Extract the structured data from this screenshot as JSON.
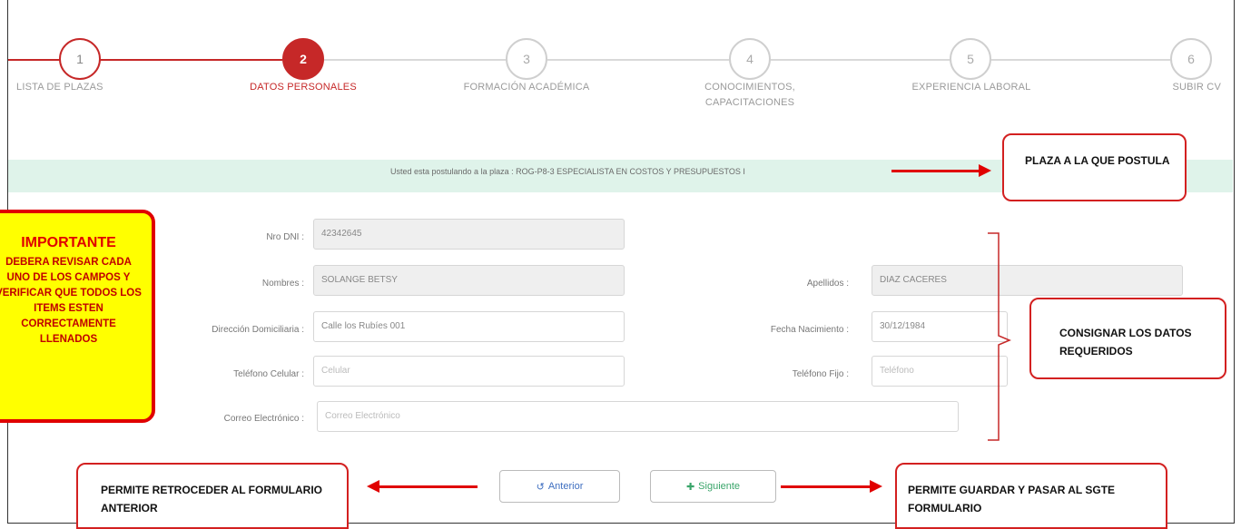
{
  "stepper": {
    "steps": [
      {
        "number": "1",
        "label": "LISTA DE PLAZAS"
      },
      {
        "number": "2",
        "label": "DATOS PERSONALES"
      },
      {
        "number": "3",
        "label": "FORMACIÓN ACADÉMICA"
      },
      {
        "number": "4",
        "label": "CONOCIMIENTOS, CAPACITACIONES"
      },
      {
        "number": "5",
        "label": "EXPERIENCIA LABORAL"
      },
      {
        "number": "6",
        "label": "SUBIR CV"
      }
    ]
  },
  "banner": {
    "text": "Usted esta postulando a la plaza : ROG-P8-3 ESPECIALISTA EN COSTOS Y PRESUPUESTOS I"
  },
  "form": {
    "dni": {
      "label": "Nro DNI :",
      "value": "42342645"
    },
    "nombres": {
      "label": "Nombres :",
      "value": "SOLANGE BETSY"
    },
    "apellidos": {
      "label": "Apellidos :",
      "value": "DIAZ CACERES"
    },
    "direccion": {
      "label": "Dirección Domiciliaria :",
      "value": "Calle los Rubíes 001"
    },
    "fecha_nacimiento": {
      "label": "Fecha Nacimiento :",
      "value": "30/12/1984"
    },
    "celular": {
      "label": "Teléfono Celular :",
      "placeholder": "Celular"
    },
    "fijo": {
      "label": "Teléfono Fijo :",
      "placeholder": "Teléfono"
    },
    "correo": {
      "label": "Correo Electrónico :",
      "placeholder": "Correo Electrónico"
    }
  },
  "buttons": {
    "anterior": "Anterior",
    "siguiente": "Siguiente"
  },
  "annotations": {
    "plaza": "PLAZA A LA QUE POSTULA",
    "consignar": "CONSIGNAR LOS DATOS REQUERIDOS",
    "retroceder": "PERMITE  RETROCEDER AL FORMULARIO ANTERIOR",
    "guardar": "PERMITE  GUARDAR Y PASAR AL SGTE FORMULARIO",
    "important_title": "IMPORTANTE",
    "important_body": "DEBERA REVISAR CADA UNO DE LOS CAMPOS Y VERIFICAR QUE TODOS LOS ITEMS ESTEN CORRECTAMENTE LLENADOS"
  },
  "colors": {
    "accent": "#c62828",
    "banner_bg": "#dff3ea",
    "callout_border": "#d32020",
    "important_bg": "#ffff00"
  }
}
